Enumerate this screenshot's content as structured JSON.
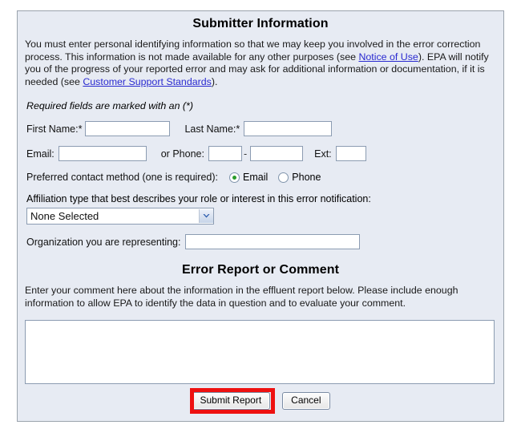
{
  "sections": {
    "submitter": {
      "title": "Submitter Information",
      "intro_part1": "You must enter personal identifying information so that we may keep you involved in the error correction process. This information is not made available for any other purposes (see ",
      "link_notice": "Notice of Use",
      "intro_part2": "). EPA will notify you of the progress of your reported error and may ask for additional information or documentation, if it is needed (see ",
      "link_support": "Customer Support Standards",
      "intro_part3": ").",
      "required_note": "Required fields are marked with an (*)"
    },
    "error_report": {
      "title": "Error Report or Comment",
      "instructions": "Enter your comment here about the information in the effluent report below. Please include enough information to allow EPA to identify the data in question and to evaluate your comment."
    }
  },
  "fields": {
    "first_name": {
      "label": "First Name:*",
      "value": "",
      "placeholder": ""
    },
    "last_name": {
      "label": "Last Name:*",
      "value": "",
      "placeholder": ""
    },
    "email": {
      "label": "Email:",
      "value": "",
      "placeholder": ""
    },
    "phone": {
      "label": "or Phone:",
      "area_value": "",
      "number_value": "",
      "separator": "-"
    },
    "ext": {
      "label": "Ext:",
      "value": ""
    },
    "organization": {
      "label": "Organization you are representing:",
      "value": "",
      "placeholder": ""
    },
    "comment": {
      "value": "",
      "placeholder": ""
    }
  },
  "contact_method": {
    "label": "Preferred contact method (one is required):",
    "options": [
      {
        "label": "Email",
        "selected": true
      },
      {
        "label": "Phone",
        "selected": false
      }
    ]
  },
  "affiliation": {
    "label": "Affiliation type that best describes your role or interest in this error notification:",
    "selected": "None Selected"
  },
  "buttons": {
    "submit": "Submit Report",
    "cancel": "Cancel"
  },
  "colors": {
    "panel_background": "#e7ebf3",
    "panel_border": "#9aa3ad",
    "link": "#2a2ad0",
    "highlight": "#ee1111",
    "radio_selected": "#2b9b2b",
    "input_border": "#8c9cb2"
  }
}
